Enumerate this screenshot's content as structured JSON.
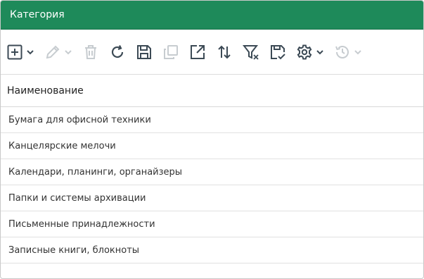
{
  "window": {
    "title": "Категория"
  },
  "toolbar": {
    "buttons": [
      {
        "icon": "add-icon",
        "has_dropdown": true,
        "enabled": true
      },
      {
        "icon": "edit-icon",
        "has_dropdown": true,
        "enabled": false
      },
      {
        "icon": "delete-icon",
        "has_dropdown": false,
        "enabled": false
      },
      {
        "icon": "refresh-icon",
        "has_dropdown": false,
        "enabled": true
      },
      {
        "icon": "save-icon",
        "has_dropdown": false,
        "enabled": true
      },
      {
        "icon": "copy-icon",
        "has_dropdown": false,
        "enabled": false
      },
      {
        "icon": "open-external-icon",
        "has_dropdown": false,
        "enabled": true
      },
      {
        "icon": "sort-icon",
        "has_dropdown": false,
        "enabled": true
      },
      {
        "icon": "clear-filter-icon",
        "has_dropdown": false,
        "enabled": true
      },
      {
        "icon": "save-settings-icon",
        "has_dropdown": false,
        "enabled": true
      },
      {
        "icon": "gear-icon",
        "has_dropdown": true,
        "enabled": true
      },
      {
        "icon": "history-icon",
        "has_dropdown": true,
        "enabled": false
      }
    ]
  },
  "table": {
    "columns": [
      "Наименование"
    ],
    "rows": [
      "Бумага для офисной техники",
      "Канцелярские мелочи",
      "Календари, планинги, органайзеры",
      "Папки и системы архивации",
      "Письменные принадлежности",
      "Записные книги, блокноты"
    ]
  },
  "colors": {
    "header_bg": "#1e8a5a",
    "icon": "#3c4a55",
    "icon_disabled": "#9aa3aa"
  }
}
